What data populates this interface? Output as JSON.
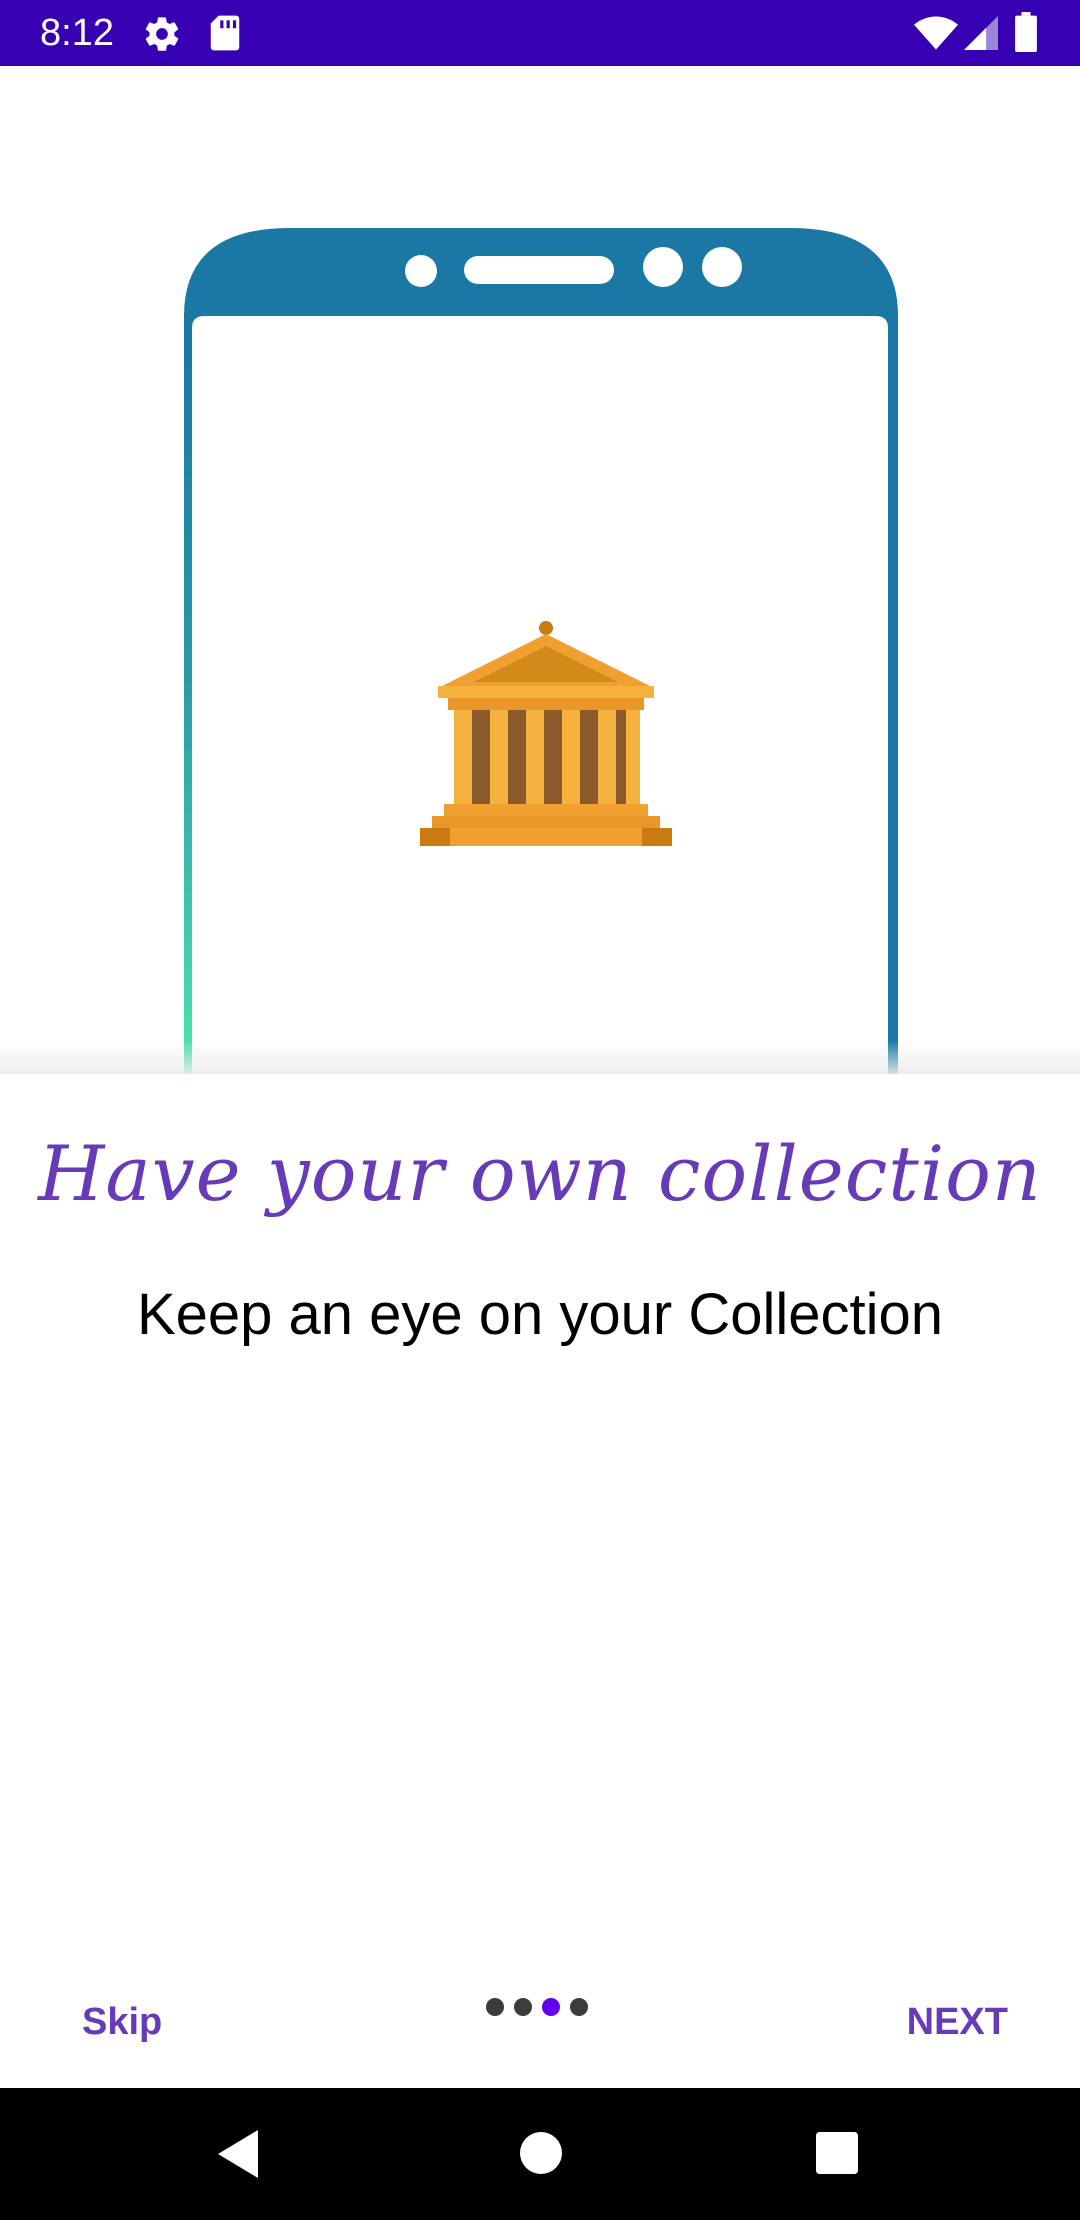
{
  "status_bar": {
    "time": "8:12",
    "icons": [
      "settings-gear-icon",
      "sd-card-icon",
      "wifi-icon",
      "cell-signal-icon",
      "battery-icon"
    ],
    "background_color": "#3700b3"
  },
  "illustration": {
    "frame_icon": "phone-outline",
    "center_icon": "museum-building-icon",
    "frame_color": "#1b78a4",
    "accent_gradient_color": "#4fe3b0",
    "museum_color": "#f0a030"
  },
  "onboarding": {
    "headline": "Have your own collection",
    "subtitle": "Keep an eye on your Collection",
    "accent_color": "#673ab7"
  },
  "pager": {
    "total_pages": 4,
    "active_page": 3
  },
  "footer": {
    "skip_label": "Skip",
    "next_label": "NEXT"
  },
  "nav_bar": {
    "icons": [
      "back-icon",
      "home-icon",
      "recents-icon"
    ]
  }
}
